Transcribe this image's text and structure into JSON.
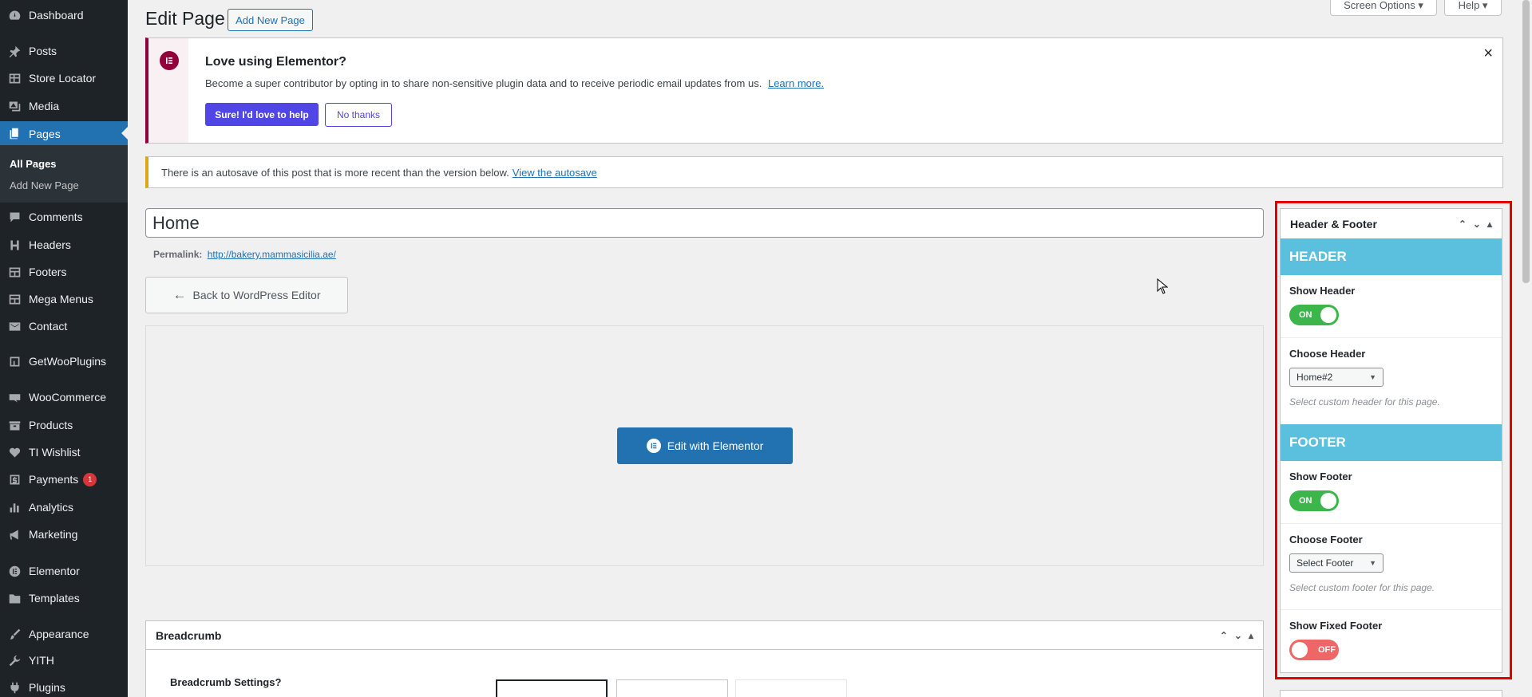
{
  "sidebar": {
    "items": [
      {
        "label": "Dashboard",
        "icon": "dashboard-icon"
      },
      {
        "label": "Posts",
        "icon": "pin-icon"
      },
      {
        "label": "Store Locator",
        "icon": "table-icon"
      },
      {
        "label": "Media",
        "icon": "media-icon"
      },
      {
        "label": "Pages",
        "icon": "pages-icon"
      },
      {
        "label": "Comments",
        "icon": "comment-icon"
      },
      {
        "label": "Headers",
        "icon": "h-icon"
      },
      {
        "label": "Footers",
        "icon": "grid-icon"
      },
      {
        "label": "Mega Menus",
        "icon": "grid-icon"
      },
      {
        "label": "Contact",
        "icon": "mail-icon"
      },
      {
        "label": "GetWooPlugins",
        "icon": "plugin-icon"
      },
      {
        "label": "WooCommerce",
        "icon": "woo-icon"
      },
      {
        "label": "Products",
        "icon": "box-icon"
      },
      {
        "label": "TI Wishlist",
        "icon": "heart-icon"
      },
      {
        "label": "Payments",
        "icon": "dollar-icon",
        "badge": "1"
      },
      {
        "label": "Analytics",
        "icon": "bar-chart-icon"
      },
      {
        "label": "Marketing",
        "icon": "megaphone-icon"
      },
      {
        "label": "Elementor",
        "icon": "elementor-icon"
      },
      {
        "label": "Templates",
        "icon": "folder-icon"
      },
      {
        "label": "Appearance",
        "icon": "brush-icon"
      },
      {
        "label": "YITH",
        "icon": "wrench-icon"
      },
      {
        "label": "Plugins",
        "icon": "plug-icon"
      }
    ],
    "submenu": [
      "All Pages",
      "Add New Page"
    ]
  },
  "header": {
    "title": "Edit Page",
    "add_new": "Add New Page",
    "screen_options": "Screen Options ▾",
    "help": "Help ▾"
  },
  "elementor_notice": {
    "title": "Love using Elementor?",
    "text": "Become a super contributor by opting in to share non-sensitive plugin data and to receive periodic email updates from us.",
    "link": "Learn more.",
    "accept": "Sure! I'd love to help",
    "decline": "No thanks",
    "close": "×"
  },
  "autosave_notice": {
    "text": "There is an autosave of this post that is more recent than the version below.",
    "link": "View the autosave"
  },
  "editor": {
    "title_value": "Home",
    "permalink_label": "Permalink:",
    "permalink_url": "http://bakery.mammasicilia.ae/",
    "back_button": "Back to WordPress Editor",
    "edit_button": "Edit with Elementor"
  },
  "breadcrumb_panel": {
    "title": "Breadcrumb",
    "setting_label": "Breadcrumb Settings?"
  },
  "header_footer_panel": {
    "title": "Header & Footer",
    "header_section": "HEADER",
    "show_header_label": "Show Header",
    "show_header_state": "ON",
    "choose_header_label": "Choose Header",
    "choose_header_value": "Home#2",
    "header_desc": "Select custom header for this page.",
    "footer_section": "FOOTER",
    "show_footer_label": "Show Footer",
    "show_footer_state": "ON",
    "choose_footer_label": "Choose Footer",
    "choose_footer_value": "Select Footer",
    "footer_desc": "Select custom footer for this page.",
    "fixed_footer_label": "Show Fixed Footer",
    "fixed_footer_state": "OFF"
  },
  "colors": {
    "admin_bar": "#1d2327",
    "accent": "#2271b1",
    "elementor": "#92003b",
    "elementor_button": "#5046e5",
    "section_header": "#5bc0de",
    "toggle_on": "#3cb54a",
    "toggle_off": "#f06666",
    "highlight": "#e00000"
  }
}
